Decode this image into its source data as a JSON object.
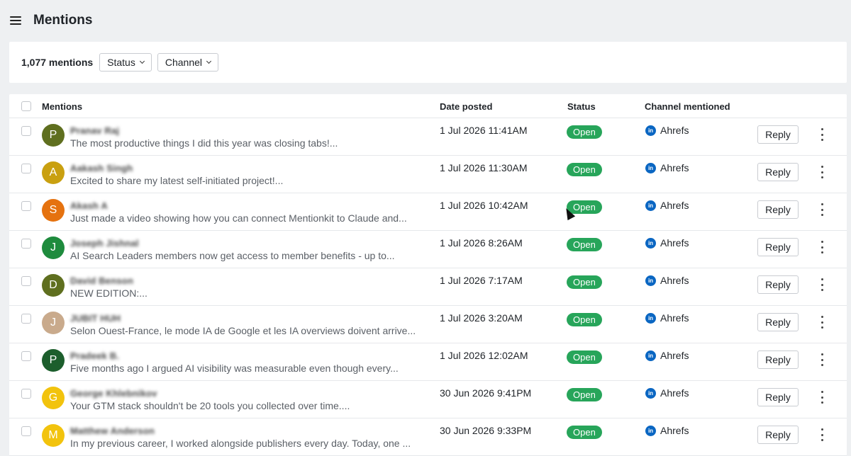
{
  "header": {
    "title": "Mentions",
    "menu_icon": "hamburger-icon"
  },
  "filters": {
    "count": "1,077 mentions",
    "status_label": "Status",
    "channel_label": "Channel"
  },
  "table": {
    "columns": {
      "mentions": "Mentions",
      "date": "Date posted",
      "status": "Status",
      "channel": "Channel mentioned"
    },
    "rows": [
      {
        "initial": "P",
        "avatar_color": "#5f6f1f",
        "author": "Pranav Raj",
        "snippet": "The most productive things I did this year was closing tabs!...",
        "date": "1 Jul 2026 11:41AM",
        "status": "Open",
        "channel": "Ahrefs",
        "reply": "Reply"
      },
      {
        "initial": "A",
        "avatar_color": "#c9a010",
        "author": "Aakash Singh",
        "snippet": "Excited to share my latest self-initiated project!...",
        "date": "1 Jul 2026 11:30AM",
        "status": "Open",
        "channel": "Ahrefs",
        "reply": "Reply"
      },
      {
        "initial": "S",
        "avatar_color": "#e5720f",
        "author": "Akash A",
        "snippet": "Just made a video showing how you can connect Mentionkit to Claude and...",
        "date": "1 Jul 2026 10:42AM",
        "status": "Open",
        "channel": "Ahrefs",
        "reply": "Reply"
      },
      {
        "initial": "J",
        "avatar_color": "#1e8b3d",
        "author": "Joseph Jishnal",
        "snippet": "AI Search Leaders members now get access to member benefits - up to...",
        "date": "1 Jul 2026 8:26AM",
        "status": "Open",
        "channel": "Ahrefs",
        "reply": "Reply"
      },
      {
        "initial": "D",
        "avatar_color": "#5f6f1f",
        "author": "David Benson",
        "snippet": "NEW EDITION:...",
        "date": "1 Jul 2026 7:17AM",
        "status": "Open",
        "channel": "Ahrefs",
        "reply": "Reply"
      },
      {
        "initial": "J",
        "avatar_color": "#c9aa8c",
        "author": "JUBIT HUH",
        "snippet": "Selon Ouest-France, le mode IA de Google et les IA overviews doivent arrive...",
        "date": "1 Jul 2026 3:20AM",
        "status": "Open",
        "channel": "Ahrefs",
        "reply": "Reply"
      },
      {
        "initial": "P",
        "avatar_color": "#1c5e2c",
        "author": "Pradeek B.",
        "snippet": "Five months ago I argued AI visibility was measurable even though every...",
        "date": "1 Jul 2026 12:02AM",
        "status": "Open",
        "channel": "Ahrefs",
        "reply": "Reply"
      },
      {
        "initial": "G",
        "avatar_color": "#f2c30d",
        "author": "George Khlebnikov",
        "snippet": "Your GTM stack shouldn't be 20 tools you collected over time....",
        "date": "30 Jun 2026 9:41PM",
        "status": "Open",
        "channel": "Ahrefs",
        "reply": "Reply"
      },
      {
        "initial": "M",
        "avatar_color": "#f2c30d",
        "author": "Matthew Anderson",
        "snippet": "In my previous career, I worked alongside publishers every day. Today, one ...",
        "date": "30 Jun 2026 9:33PM",
        "status": "Open",
        "channel": "Ahrefs",
        "reply": "Reply"
      }
    ]
  }
}
